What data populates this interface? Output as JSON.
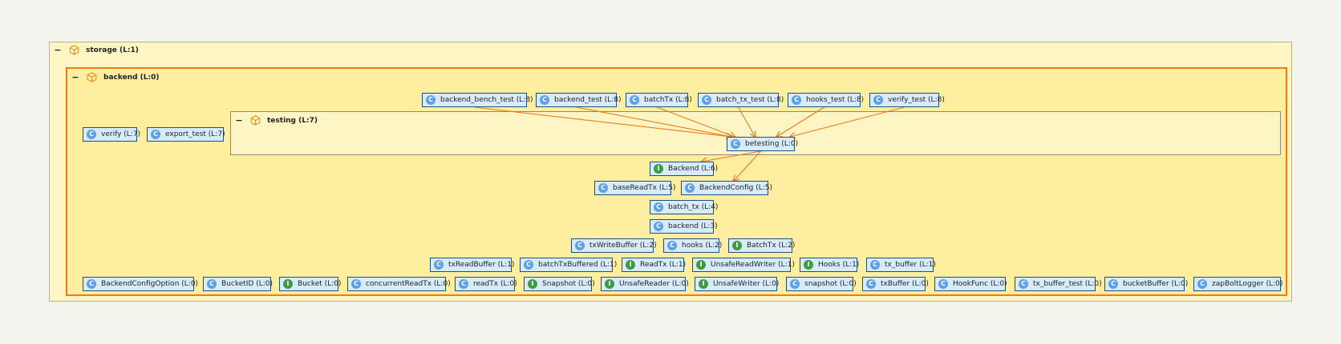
{
  "colors": {
    "class_badge": "#5ea0e6",
    "interface_badge": "#3f9a43",
    "edge": "#f07a1a",
    "highlight_border": "#f07a1a",
    "node_fill": "#d8ebf8",
    "node_border": "#1d4f86"
  },
  "packages": {
    "storage": {
      "label": "storage (L:1)",
      "collapse": "−",
      "icon": "package-icon"
    },
    "backend": {
      "label": "backend (L:0)",
      "collapse": "−",
      "icon": "package-icon"
    },
    "testing": {
      "label": "testing (L:7)",
      "collapse": "−",
      "icon": "package-icon"
    }
  },
  "nodes": [
    {
      "id": "backend_bench_test",
      "label": "backend_bench_test (L:8)",
      "kind": "C"
    },
    {
      "id": "backend_test",
      "label": "backend_test (L:8)",
      "kind": "C"
    },
    {
      "id": "batchTx_file",
      "label": "batchTx (L:8)",
      "kind": "C"
    },
    {
      "id": "batch_tx_test",
      "label": "batch_tx_test (L:8)",
      "kind": "C"
    },
    {
      "id": "hooks_test",
      "label": "hooks_test (L:8)",
      "kind": "C"
    },
    {
      "id": "verify_test",
      "label": "verify_test (L:8)",
      "kind": "C"
    },
    {
      "id": "verify",
      "label": "verify (L:7)",
      "kind": "C"
    },
    {
      "id": "export_test",
      "label": "export_test (L:7)",
      "kind": "C"
    },
    {
      "id": "betesting",
      "label": "betesting (L:0)",
      "kind": "C"
    },
    {
      "id": "Backend",
      "label": "Backend (L:6)",
      "kind": "I"
    },
    {
      "id": "baseReadTx",
      "label": "baseReadTx (L:5)",
      "kind": "C"
    },
    {
      "id": "BackendConfig",
      "label": "BackendConfig (L:5)",
      "kind": "C"
    },
    {
      "id": "batch_tx",
      "label": "batch_tx (L:4)",
      "kind": "C"
    },
    {
      "id": "backend_file",
      "label": "backend (L:3)",
      "kind": "C"
    },
    {
      "id": "txWriteBuffer",
      "label": "txWriteBuffer (L:2)",
      "kind": "C"
    },
    {
      "id": "hooks",
      "label": "hooks (L:2)",
      "kind": "C"
    },
    {
      "id": "BatchTx",
      "label": "BatchTx (L:2)",
      "kind": "I"
    },
    {
      "id": "txReadBuffer",
      "label": "txReadBuffer (L:1)",
      "kind": "C"
    },
    {
      "id": "batchTxBuffered",
      "label": "batchTxBuffered (L:1)",
      "kind": "C"
    },
    {
      "id": "ReadTx",
      "label": "ReadTx (L:1)",
      "kind": "I"
    },
    {
      "id": "UnsafeReadWriter",
      "label": "UnsafeReadWriter (L:1)",
      "kind": "I"
    },
    {
      "id": "Hooks",
      "label": "Hooks (L:1)",
      "kind": "I"
    },
    {
      "id": "tx_buffer",
      "label": "tx_buffer (L:1)",
      "kind": "C"
    },
    {
      "id": "BackendConfigOption",
      "label": "BackendConfigOption (L:0)",
      "kind": "C"
    },
    {
      "id": "BucketID",
      "label": "BucketID (L:0)",
      "kind": "C"
    },
    {
      "id": "Bucket",
      "label": "Bucket (L:0)",
      "kind": "I"
    },
    {
      "id": "concurrentReadTx",
      "label": "concurrentReadTx (L:0)",
      "kind": "C"
    },
    {
      "id": "readTx",
      "label": "readTx (L:0)",
      "kind": "C"
    },
    {
      "id": "Snapshot",
      "label": "Snapshot (L:0)",
      "kind": "I"
    },
    {
      "id": "UnsafeReader",
      "label": "UnsafeReader (L:0)",
      "kind": "I"
    },
    {
      "id": "UnsafeWriter",
      "label": "UnsafeWriter (L:0)",
      "kind": "I"
    },
    {
      "id": "snapshot",
      "label": "snapshot (L:0)",
      "kind": "C"
    },
    {
      "id": "txBuffer",
      "label": "txBuffer (L:0)",
      "kind": "C"
    },
    {
      "id": "HookFunc",
      "label": "HookFunc (L:0)",
      "kind": "C"
    },
    {
      "id": "tx_buffer_test",
      "label": "tx_buffer_test (L:0)",
      "kind": "C"
    },
    {
      "id": "bucketBuffer",
      "label": "bucketBuffer (L:0)",
      "kind": "C"
    },
    {
      "id": "zapBoltLogger",
      "label": "zapBoltLogger (L:0)",
      "kind": "C"
    }
  ],
  "edges": [
    {
      "from": "backend_bench_test",
      "to": "betesting"
    },
    {
      "from": "backend_test",
      "to": "betesting"
    },
    {
      "from": "batchTx_file",
      "to": "betesting"
    },
    {
      "from": "batch_tx_test",
      "to": "betesting"
    },
    {
      "from": "hooks_test",
      "to": "betesting"
    },
    {
      "from": "verify_test",
      "to": "betesting"
    },
    {
      "from": "betesting",
      "to": "Backend"
    },
    {
      "from": "betesting",
      "to": "BackendConfig"
    }
  ]
}
